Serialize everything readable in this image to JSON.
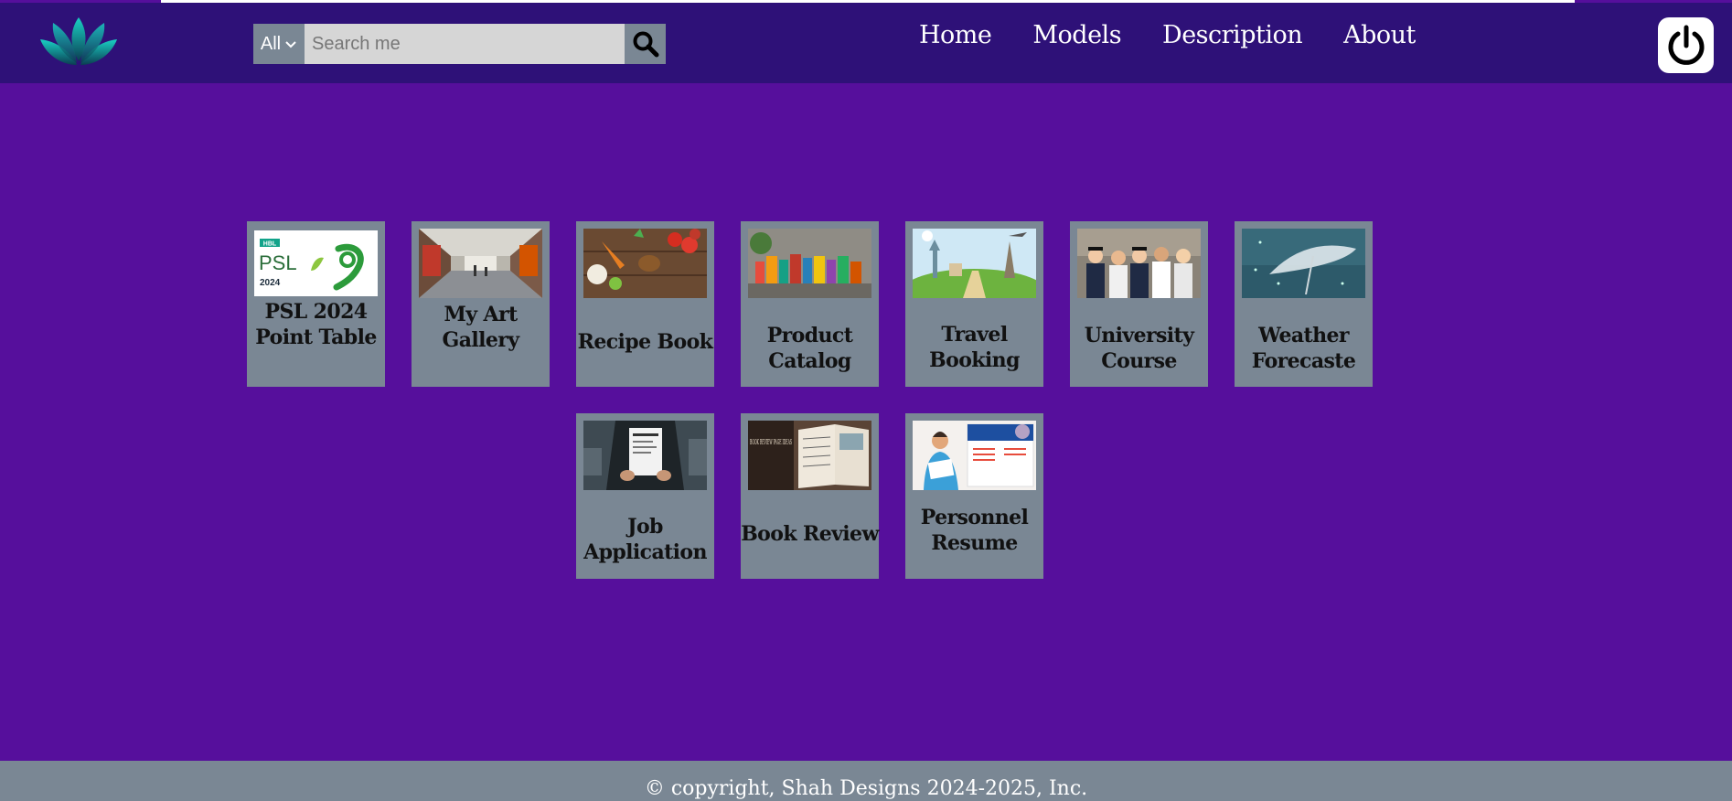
{
  "header": {
    "logo_icon": "lotus-icon",
    "search": {
      "category": "All",
      "placeholder": "Search me",
      "icon": "magnifier-icon"
    },
    "nav": [
      "Home",
      "Models",
      "Description",
      "About"
    ],
    "power_icon": "power-icon"
  },
  "cards": [
    {
      "title": "PSL 2024 Point Table",
      "image": "psl-2024-logo"
    },
    {
      "title": "My Art Gallery",
      "image": "art-gallery-hall"
    },
    {
      "title": "Recipe Book",
      "image": "vegetables-spices"
    },
    {
      "title": "Product Catalog",
      "image": "product-shelf"
    },
    {
      "title": "Travel Booking",
      "image": "world-landmarks"
    },
    {
      "title": "University Course",
      "image": "graduates-group"
    },
    {
      "title": "Weather Forecaste",
      "image": "umbrella-rain"
    },
    {
      "title": "Job Application",
      "image": "resume-hands"
    },
    {
      "title": "Book Review",
      "image": "book-review-pages"
    },
    {
      "title": "Personnel Resume",
      "image": "cover-letter-illustration"
    }
  ],
  "thumb_text": {
    "psl_hbl": "HBL",
    "psl_main": "PSL",
    "psl_year": "2024",
    "book_review": "BOOK REVIEW PAGE IDEAS"
  },
  "footer": {
    "text": "© copyright, Shah Designs 2024-2025, Inc."
  },
  "colors": {
    "page_bg": "#560f9c",
    "header_bg": "#2e1178",
    "card_bg": "#7a8794",
    "footer_bg": "#7a8794"
  }
}
